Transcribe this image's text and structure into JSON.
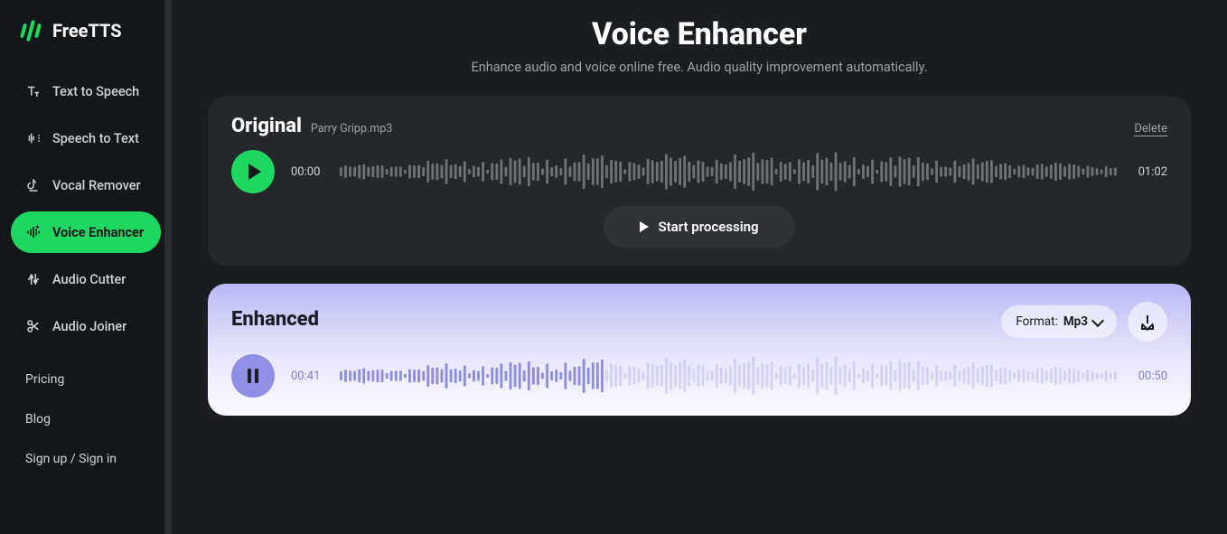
{
  "brand": "FreeTTS",
  "sidebar": {
    "items": [
      {
        "label": "Text to Speech"
      },
      {
        "label": "Speech to Text"
      },
      {
        "label": "Vocal Remover"
      },
      {
        "label": "Voice Enhancer"
      },
      {
        "label": "Audio Cutter"
      },
      {
        "label": "Audio Joiner"
      }
    ],
    "secondary": [
      {
        "label": "Pricing"
      },
      {
        "label": "Blog"
      },
      {
        "label": "Sign up / Sign in"
      }
    ]
  },
  "header": {
    "title": "Voice Enhancer",
    "subtitle": "Enhance audio and voice online free. Audio quality improvement automatically."
  },
  "original": {
    "title": "Original",
    "filename": "Parry Gripp.mp3",
    "delete_label": "Delete",
    "current_time": "00:00",
    "total_time": "01:02",
    "process_label": "Start processing"
  },
  "enhanced": {
    "title": "Enhanced",
    "format_label": "Format:",
    "format_value": "Mp3",
    "current_time": "00:41",
    "total_time": "00:50"
  }
}
